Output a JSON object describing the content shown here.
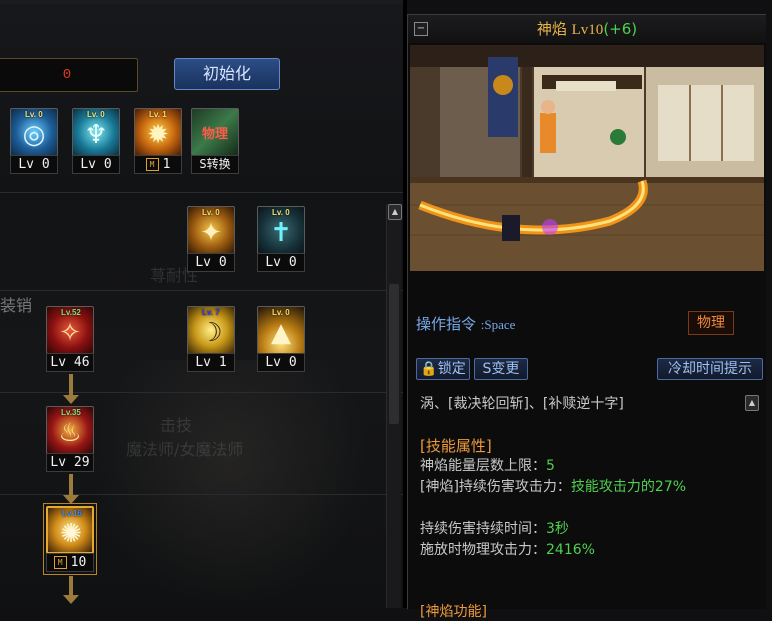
{
  "left": {
    "sp_value": "0",
    "reset_label": "初始化",
    "faint_labels": [
      "荨耐性",
      "装销",
      "击技",
      "魔法师/女魔法师"
    ],
    "row1": [
      {
        "name": "skill-1",
        "lv_tag": "Lv. 0",
        "level": "Lv 0",
        "glyph": "◎",
        "color": "#3a8bd0"
      },
      {
        "name": "skill-2",
        "lv_tag": "Lv. 0",
        "level": "Lv 0",
        "glyph": "♆",
        "color": "#2aa9c8"
      },
      {
        "name": "skill-3",
        "lv_tag": "Lv. 1",
        "level": "1",
        "glyph": "✹",
        "color": "#d47a18",
        "mark": "M"
      },
      {
        "name": "skill-4",
        "lv_tag": "",
        "level": "S转换",
        "glyph": "物理",
        "color": "#2c6a3c"
      }
    ],
    "row2": [
      {
        "name": "skill-5",
        "lv_tag": "Lv. 0",
        "level": "Lv 0",
        "glyph": "✦",
        "color": "#c88a18"
      },
      {
        "name": "skill-6",
        "lv_tag": "Lv. 0",
        "level": "Lv 0",
        "glyph": "✝",
        "color": "#28a8b8"
      }
    ],
    "row3": [
      {
        "name": "skill-7",
        "lv_tag": "Lv.52",
        "level": "Lv 46",
        "glyph": "✧",
        "color": "#b02020"
      },
      {
        "name": "skill-8",
        "lv_tag": "Lv. 7",
        "level": "Lv 1",
        "glyph": "☽",
        "color": "#c89818"
      },
      {
        "name": "skill-9",
        "lv_tag": "Lv. 0",
        "level": "Lv 0",
        "glyph": "▲",
        "color": "#d0a020"
      }
    ],
    "row4": [
      {
        "name": "skill-10",
        "lv_tag": "Lv.35",
        "level": "Lv 29",
        "glyph": "♨",
        "color": "#a81818"
      }
    ],
    "row5": [
      {
        "name": "skill-11",
        "lv_tag": "Lv.16",
        "level": "10",
        "glyph": "✺",
        "color": "#c88a18",
        "mark": "M"
      }
    ]
  },
  "right": {
    "skill_name": "神焰",
    "skill_level": "Lv10",
    "skill_bonus": "(+6)",
    "collapse_label": "−",
    "command_label": "操作指令",
    "command_key": ":Space",
    "type_badge": "物理",
    "lock_label": "锁定",
    "change_label": "S变更",
    "cooldown_label": "冷却时间提示",
    "prev_text": "涡、[裁决轮回斩]、[补赎逆十字]",
    "attr_header": "[技能属性]",
    "attrs": [
      {
        "label": "神焰能量层数上限：",
        "value": "5"
      },
      {
        "label": "[神焰]持续伤害攻击力：",
        "value": "技能攻击力的27%"
      },
      {
        "label": "持续伤害持续时间：",
        "value": "3秒"
      },
      {
        "label": "施放时物理攻击力：",
        "value": "2416%"
      }
    ],
    "next_header": "[神焰功能]"
  },
  "colors": {
    "accent_gold": "#e8b54a",
    "green_value": "#4fd04f",
    "blue_label": "#79a8e8",
    "orange_header": "#ef9a3a"
  }
}
